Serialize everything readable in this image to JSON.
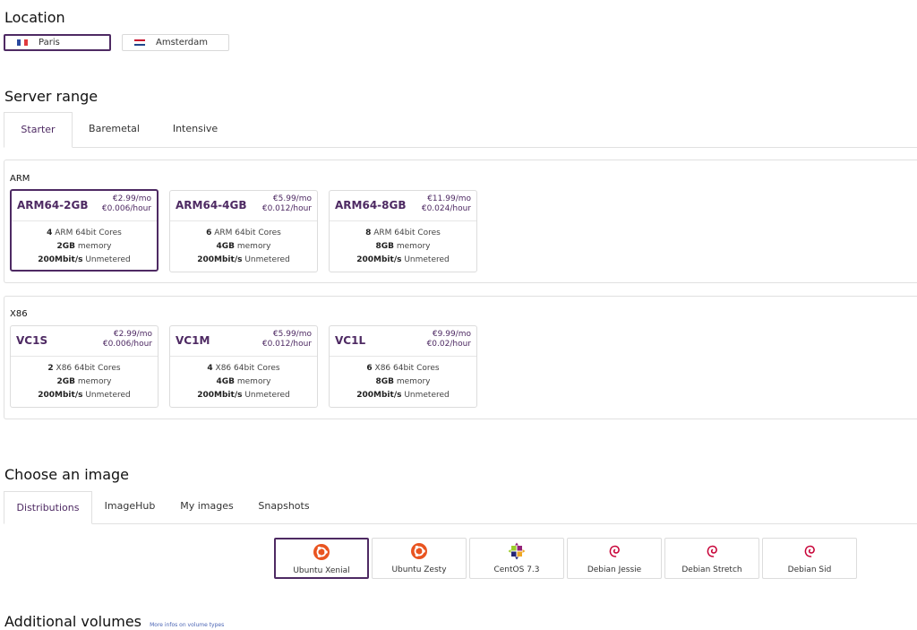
{
  "location": {
    "title": "Location",
    "options": [
      {
        "label": "Paris",
        "selected": true,
        "flag": "france-flag"
      },
      {
        "label": "Amsterdam",
        "selected": false,
        "flag": "netherlands-flag"
      }
    ]
  },
  "server_range": {
    "title": "Server range",
    "tabs": [
      {
        "label": "Starter",
        "active": true
      },
      {
        "label": "Baremetal",
        "active": false
      },
      {
        "label": "Intensive",
        "active": false
      }
    ],
    "groups": [
      {
        "label": "ARM",
        "servers": [
          {
            "name": "ARM64-2GB",
            "price_month": "€2.99/mo",
            "price_hour": "€0.006/hour",
            "cores_num": "4",
            "cores_text": " ARM 64bit Cores",
            "memory_num": "2GB",
            "memory_text": " memory",
            "bw_num": "200Mbit/s",
            "bw_text": " Unmetered",
            "selected": true
          },
          {
            "name": "ARM64-4GB",
            "price_month": "€5.99/mo",
            "price_hour": "€0.012/hour",
            "cores_num": "6",
            "cores_text": " ARM 64bit Cores",
            "memory_num": "4GB",
            "memory_text": " memory",
            "bw_num": "200Mbit/s",
            "bw_text": " Unmetered",
            "selected": false
          },
          {
            "name": "ARM64-8GB",
            "price_month": "€11.99/mo",
            "price_hour": "€0.024/hour",
            "cores_num": "8",
            "cores_text": " ARM 64bit Cores",
            "memory_num": "8GB",
            "memory_text": " memory",
            "bw_num": "200Mbit/s",
            "bw_text": " Unmetered",
            "selected": false
          }
        ]
      },
      {
        "label": "X86",
        "servers": [
          {
            "name": "VC1S",
            "price_month": "€2.99/mo",
            "price_hour": "€0.006/hour",
            "cores_num": "2",
            "cores_text": " X86 64bit Cores",
            "memory_num": "2GB",
            "memory_text": " memory",
            "bw_num": "200Mbit/s",
            "bw_text": " Unmetered",
            "selected": false
          },
          {
            "name": "VC1M",
            "price_month": "€5.99/mo",
            "price_hour": "€0.012/hour",
            "cores_num": "4",
            "cores_text": " X86 64bit Cores",
            "memory_num": "4GB",
            "memory_text": " memory",
            "bw_num": "200Mbit/s",
            "bw_text": " Unmetered",
            "selected": false
          },
          {
            "name": "VC1L",
            "price_month": "€9.99/mo",
            "price_hour": "€0.02/hour",
            "cores_num": "6",
            "cores_text": " X86 64bit Cores",
            "memory_num": "8GB",
            "memory_text": " memory",
            "bw_num": "200Mbit/s",
            "bw_text": " Unmetered",
            "selected": false
          }
        ]
      }
    ]
  },
  "image": {
    "title": "Choose an image",
    "tabs": [
      {
        "label": "Distributions",
        "active": true
      },
      {
        "label": "ImageHub",
        "active": false
      },
      {
        "label": "My images",
        "active": false
      },
      {
        "label": "Snapshots",
        "active": false
      }
    ],
    "options": [
      {
        "label": "Ubuntu Xenial",
        "icon": "ubuntu-icon",
        "selected": true
      },
      {
        "label": "Ubuntu Zesty",
        "icon": "ubuntu-icon",
        "selected": false
      },
      {
        "label": "CentOS 7.3",
        "icon": "centos-icon",
        "selected": false
      },
      {
        "label": "Debian Jessie",
        "icon": "debian-icon",
        "selected": false
      },
      {
        "label": "Debian Stretch",
        "icon": "debian-icon",
        "selected": false
      },
      {
        "label": "Debian Sid",
        "icon": "debian-icon",
        "selected": false
      }
    ]
  },
  "volumes": {
    "title": "Additional volumes",
    "link": "More infos on volume types"
  },
  "colors": {
    "accent": "#4e2a63",
    "ubuntu": "#e95420",
    "debian": "#c70036",
    "link": "#4a64b4"
  }
}
